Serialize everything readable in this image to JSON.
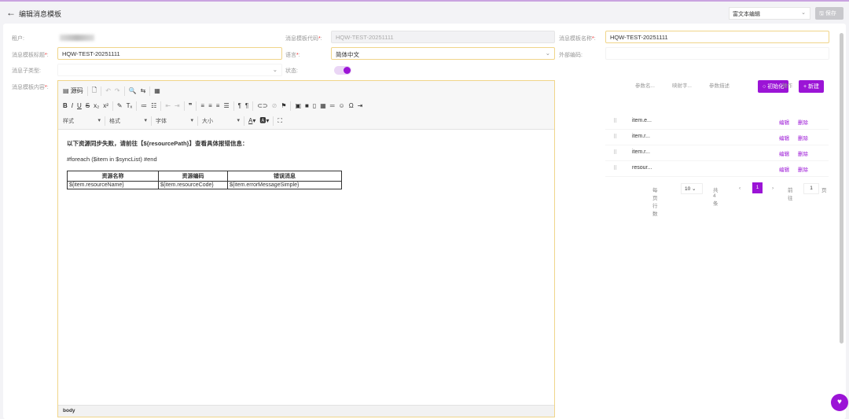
{
  "header": {
    "back_icon": "←",
    "title": "编辑消息模板",
    "mode": "富文本编辑",
    "save": "保存"
  },
  "form": {
    "tenant_label": "租户:",
    "code_label": "消息模板代码",
    "code_value": "HQW-TEST-20251111",
    "name_label": "消息模板名称",
    "name_value": "HQW-TEST-20251111",
    "title_label": "消息模板标题",
    "title_value": "HQW-TEST-20251111",
    "lang_label": "语言",
    "lang_value": "简体中文",
    "ext_label": "外部编码:",
    "subtype_label": "消息子类型:",
    "status_label": "状态:",
    "content_label": "消息模板内容"
  },
  "editor": {
    "source": "源码",
    "style": "样式",
    "format": "格式",
    "font": "字体",
    "size": "大小",
    "line1": "以下资源同步失败，请前往【${resourcePath}】查看具体报错信息：",
    "line2": "#foreach ($item in $syncList) #end",
    "table_headers": [
      "资源名称",
      "资源编码",
      "错误消息"
    ],
    "table_cells": [
      "${item.resourceName}",
      "${item.resourceCode}",
      "${item.errorMessageSimple}"
    ],
    "path": "body"
  },
  "params": {
    "init": "初始化",
    "new": "新建",
    "headers": [
      "参数名...",
      "映射字...",
      "参数描述",
      "操作"
    ],
    "rows": [
      {
        "name": "item.e..."
      },
      {
        "name": "item.r..."
      },
      {
        "name": "item.r..."
      },
      {
        "name": "resour..."
      }
    ],
    "edit": "编辑",
    "delete": "删除",
    "page_size_label": "每页行数",
    "page_size": "10",
    "total": "共4条",
    "page": "1",
    "goto_label": "前往",
    "goto_value": "1",
    "page_unit": "页"
  },
  "colors": {
    "accent": "#9b14d6"
  }
}
